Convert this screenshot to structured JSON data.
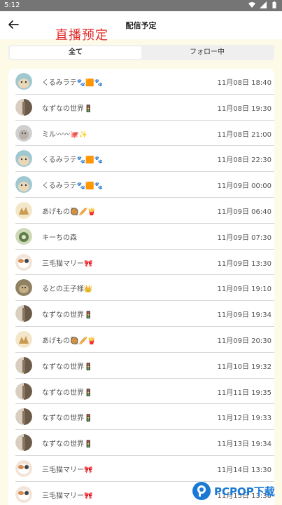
{
  "status_bar": {
    "time": "5:12"
  },
  "header": {
    "title": "配信予定",
    "overlay_title": "直播预定"
  },
  "tabs": [
    {
      "label": "全て",
      "active": true
    },
    {
      "label": "フォロー中",
      "active": false
    }
  ],
  "schedule": [
    {
      "name": "くるみラテ🐾🟧🐾",
      "date": "11月08日",
      "time": "18:40",
      "avatar": "cat"
    },
    {
      "name": "なずなの世界🚦",
      "date": "11月08日",
      "time": "19:30",
      "avatar": "cat-dark"
    },
    {
      "name": "ミル〰〰🐙✨",
      "date": "11月08日",
      "time": "21:00",
      "avatar": "kitten"
    },
    {
      "name": "くるみラテ🐾🟧🐾",
      "date": "11月08日",
      "time": "22:30",
      "avatar": "cat"
    },
    {
      "name": "くるみラテ🐾🟧🐾",
      "date": "11月09日",
      "time": "00:00",
      "avatar": "cat"
    },
    {
      "name": "あげもの🥘🥖🍟",
      "date": "11月09日",
      "time": "06:40",
      "avatar": "illustration"
    },
    {
      "name": "キーちの森",
      "date": "11月09日",
      "time": "07:30",
      "avatar": "forest"
    },
    {
      "name": "三毛猫マリー🎀",
      "date": "11月09日",
      "time": "13:30",
      "avatar": "calico"
    },
    {
      "name": "るとの王子様👑",
      "date": "11月09日",
      "time": "19:10",
      "avatar": "brown"
    },
    {
      "name": "なずなの世界🚦",
      "date": "11月09日",
      "time": "19:34",
      "avatar": "cat-dark"
    },
    {
      "name": "あげもの🥘🥖🍟",
      "date": "11月09日",
      "time": "20:30",
      "avatar": "illustration"
    },
    {
      "name": "なずなの世界🚦",
      "date": "11月10日",
      "time": "19:32",
      "avatar": "cat-dark"
    },
    {
      "name": "なずなの世界🚦",
      "date": "11月11日",
      "time": "19:35",
      "avatar": "cat-dark"
    },
    {
      "name": "なずなの世界🚦",
      "date": "11月12日",
      "time": "19:33",
      "avatar": "cat-dark"
    },
    {
      "name": "なずなの世界🚦",
      "date": "11月13日",
      "time": "19:34",
      "avatar": "cat-dark"
    },
    {
      "name": "三毛猫マリー🎀",
      "date": "11月14日",
      "time": "13:30",
      "avatar": "calico"
    },
    {
      "name": "三毛猫マリー🎀",
      "date": "11月15日",
      "time": "13:30",
      "avatar": "calico"
    }
  ],
  "watermark": {
    "text": "PCPOP下载"
  },
  "colors": {
    "background": "#fdfbe8",
    "overlay_title": "#e32a2a",
    "watermark": "#1b79d6"
  }
}
